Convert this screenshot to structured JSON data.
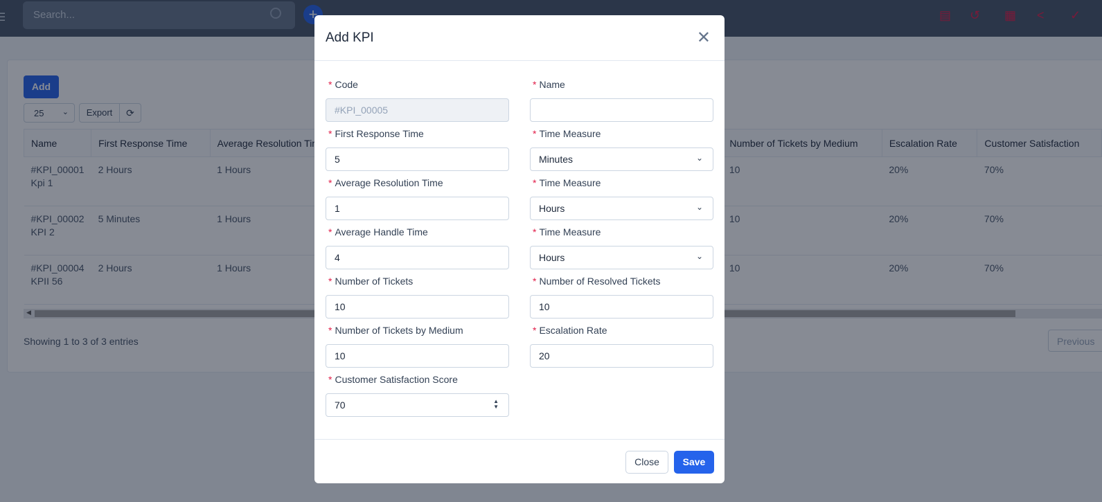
{
  "topbar": {
    "search_placeholder": "Search...",
    "icons": [
      "contact-card-icon",
      "history-icon",
      "qr-code-icon",
      "share-icon",
      "check-icon"
    ]
  },
  "toolbar": {
    "add_label": "Add",
    "page_size": "25",
    "export_label": "Export"
  },
  "table": {
    "headers": [
      "Name",
      "First Response Time",
      "Average Resolution Tim",
      "Number of Tickets by Medium",
      "Escalation Rate",
      "Customer Satisfaction"
    ],
    "rows": [
      {
        "code": "#KPI_00001",
        "name": "Kpi 1",
        "frt": "2 Hours",
        "art": "1 Hours",
        "medium": "10",
        "esc": "20%",
        "csat": "70%"
      },
      {
        "code": "#KPI_00002",
        "name": "KPI 2",
        "frt": "5 Minutes",
        "art": "1 Hours",
        "medium": "10",
        "esc": "20%",
        "csat": "70%"
      },
      {
        "code": "#KPI_00004",
        "name": "KPII 56",
        "frt": "2 Hours",
        "art": "1 Hours",
        "medium": "10",
        "esc": "20%",
        "csat": "70%"
      }
    ]
  },
  "footer": {
    "showing": "Showing 1 to 3 of 3 entries",
    "previous": "Previous"
  },
  "modal": {
    "title": "Add KPI",
    "fields": [
      {
        "label": "Code",
        "value": "#KPI_00005"
      },
      {
        "label": "Name",
        "value": ""
      },
      {
        "label": "First Response Time",
        "value": "5"
      },
      {
        "label": "Time Measure",
        "value": "Minutes"
      },
      {
        "label": "Average Resolution Time",
        "value": "1"
      },
      {
        "label": "Time Measure",
        "value": "Hours"
      },
      {
        "label": "Average Handle Time",
        "value": "4"
      },
      {
        "label": "Time Measure",
        "value": "Hours"
      },
      {
        "label": "Number of Tickets",
        "value": "10"
      },
      {
        "label": "Number of Resolved Tickets",
        "value": "10"
      },
      {
        "label": "Number of Tickets by Medium",
        "value": "10"
      },
      {
        "label": "Escalation Rate",
        "value": "20"
      },
      {
        "label": "Customer Satisfaction Score",
        "value": "70"
      }
    ],
    "close_label": "Close",
    "save_label": "Save"
  }
}
